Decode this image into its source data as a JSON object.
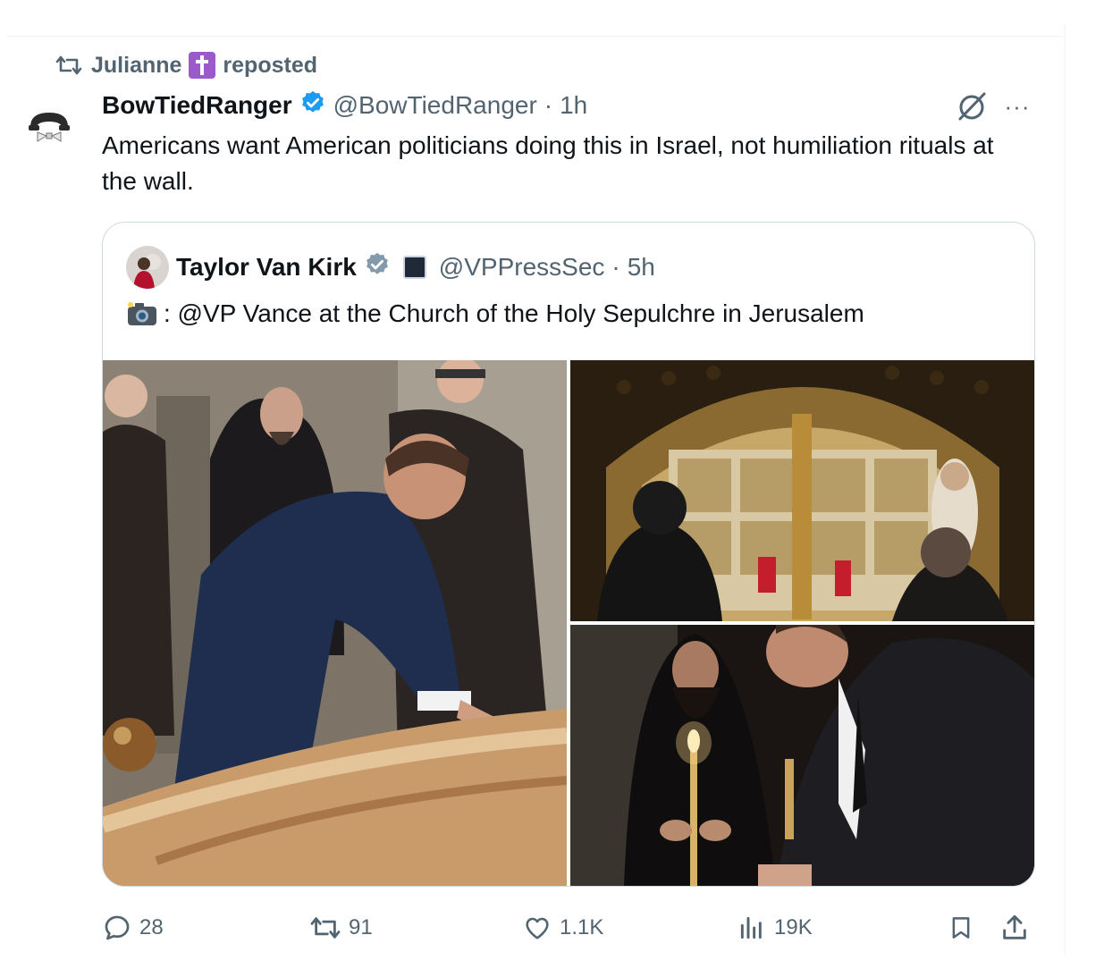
{
  "repost": {
    "user": "Julianne",
    "label": "reposted"
  },
  "tweet": {
    "display_name": "BowTiedRanger",
    "handle": "@BowTiedRanger",
    "separator": "·",
    "time": "1h",
    "more": "···",
    "text": "Americans want American politicians doing this in Israel, not humiliation rituals at the wall."
  },
  "quote": {
    "display_name": "Taylor Van Kirk",
    "handle": "@VPPressSec",
    "separator": "·",
    "time": "5h",
    "text": ": @VP Vance at the Church of the Holy Sepulchre in Jerusalem"
  },
  "actions": {
    "replies": "28",
    "reposts": "91",
    "likes": "1.1K",
    "views": "19K"
  },
  "colors": {
    "text": "#0f1419",
    "secondary": "#536471",
    "verified": "#1d9bf0",
    "border": "#cfd9de"
  },
  "icons": [
    "repost-icon",
    "cross-emoji-icon",
    "verified-badge-icon",
    "grok-icon",
    "more-icon",
    "government-badge-icon",
    "camera-flash-emoji-icon",
    "reply-icon",
    "like-icon",
    "views-icon",
    "bookmark-icon",
    "share-icon"
  ]
}
